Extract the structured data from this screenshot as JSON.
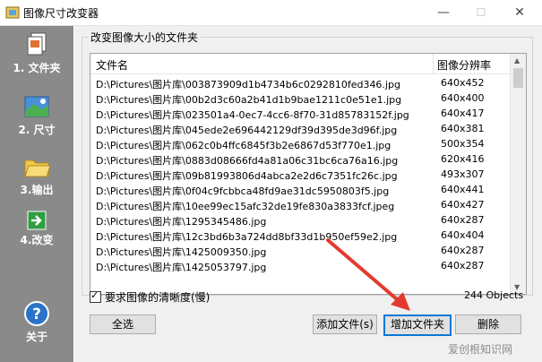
{
  "window": {
    "title": "图像尺寸改变器",
    "controls": {
      "minimize": "—",
      "maximize": "☐",
      "close": "✕"
    }
  },
  "sidebar": {
    "items": [
      {
        "label": "1. 文件夹",
        "icon": "files-icon"
      },
      {
        "label": "2. 尺寸",
        "icon": "image-icon"
      },
      {
        "label": "3.输出",
        "icon": "folder-icon"
      },
      {
        "label": "4.改变",
        "icon": "arrow-right-icon"
      }
    ],
    "about": {
      "label": "关于",
      "icon": "help-icon"
    }
  },
  "main": {
    "group_title": "改变图像大小的文件夹",
    "columns": [
      "文件名",
      "图像分辨率"
    ],
    "rows": [
      {
        "name": "D:\\Pictures\\图片库\\003873909d1b4734b6c0292810fed346.jpg",
        "res": "640x452"
      },
      {
        "name": "D:\\Pictures\\图片库\\00b2d3c60a2b41d1b9bae1211c0e51e1.jpg",
        "res": "640x400"
      },
      {
        "name": "D:\\Pictures\\图片库\\023501a4-0ec7-4cc6-8f70-31d85783152f.jpg",
        "res": "640x417"
      },
      {
        "name": "D:\\Pictures\\图片库\\045ede2e696442129df39d395de3d96f.jpg",
        "res": "640x381"
      },
      {
        "name": "D:\\Pictures\\图片库\\062c0b4ffc6845f3b2e6867d53f770e1.jpg",
        "res": "500x354"
      },
      {
        "name": "D:\\Pictures\\图片库\\0883d08666fd4a81a06c31bc6ca76a16.jpg",
        "res": "620x416"
      },
      {
        "name": "D:\\Pictures\\图片库\\09b81993806d4abca2e2d6c7351fc26c.jpg",
        "res": "493x307"
      },
      {
        "name": "D:\\Pictures\\图片库\\0f04c9fcbbca48fd9ae31dc5950803f5.jpg",
        "res": "640x441"
      },
      {
        "name": "D:\\Pictures\\图片库\\10ee99ec15afc32de19fe830a3833fcf.jpeg",
        "res": "640x427"
      },
      {
        "name": "D:\\Pictures\\图片库\\1295345486.jpg",
        "res": "640x287"
      },
      {
        "name": "D:\\Pictures\\图片库\\12c3bd6b3a724dd8bf33d1b950ef59e2.jpg",
        "res": "640x404"
      },
      {
        "name": "D:\\Pictures\\图片库\\1425009350.jpg",
        "res": "640x287"
      },
      {
        "name": "D:\\Pictures\\图片库\\1425053797.jpg",
        "res": "640x287"
      }
    ],
    "checkbox_label": "要求图像的清晰度(慢)",
    "checkbox_checked": true,
    "object_count": "244 Objects"
  },
  "buttons": {
    "select_all": "全选",
    "add_files": "添加文件(s)",
    "add_folder": "增加文件夹",
    "delete": "删除"
  },
  "watermark": "爱创根知识网"
}
